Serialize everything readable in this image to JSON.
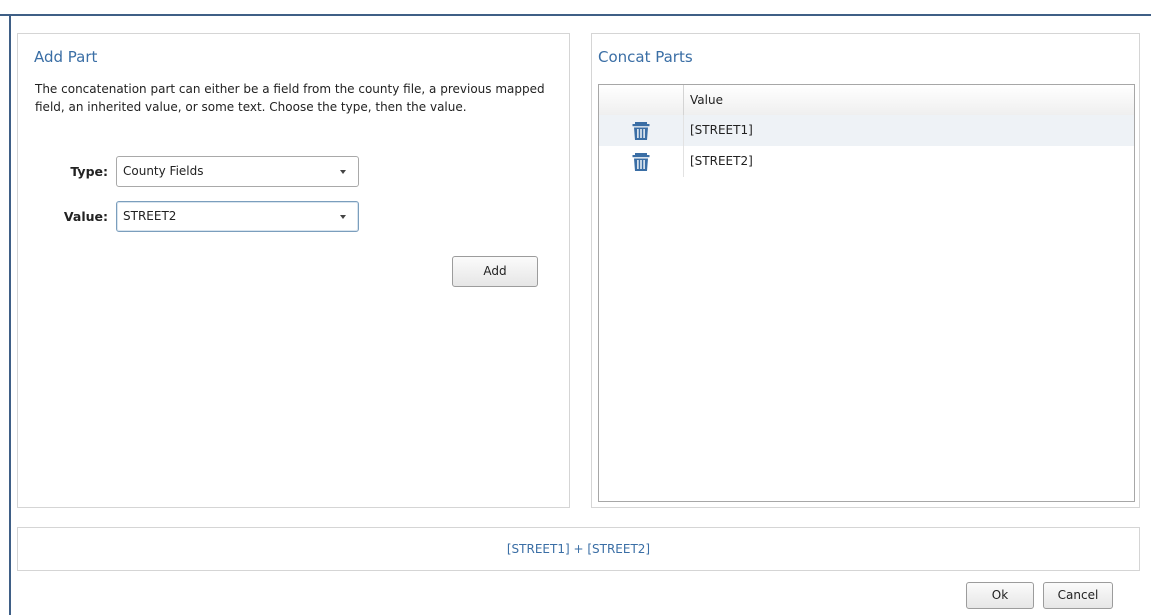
{
  "add_part": {
    "title": "Add Part",
    "description": "The concatenation part can either be a field from the county file, a previous mapped field, an inherited value, or some text.  Choose the type, then the value.",
    "type_label": "Type:",
    "type_value": "County Fields",
    "value_label": "Value:",
    "value_value": "STREET2",
    "add_button": "Add"
  },
  "concat_parts": {
    "title": "Concat Parts",
    "column_header": "Value",
    "rows": [
      {
        "value": "[STREET1]",
        "icon": "trash-icon"
      },
      {
        "value": "[STREET2]",
        "icon": "trash-icon"
      }
    ]
  },
  "expression": "[STREET1] + [STREET2]",
  "buttons": {
    "ok": "Ok",
    "cancel": "Cancel"
  },
  "colors": {
    "accent": "#3a6ea5",
    "frame": "#3f5f86",
    "row_highlight": "#eef2f6"
  }
}
